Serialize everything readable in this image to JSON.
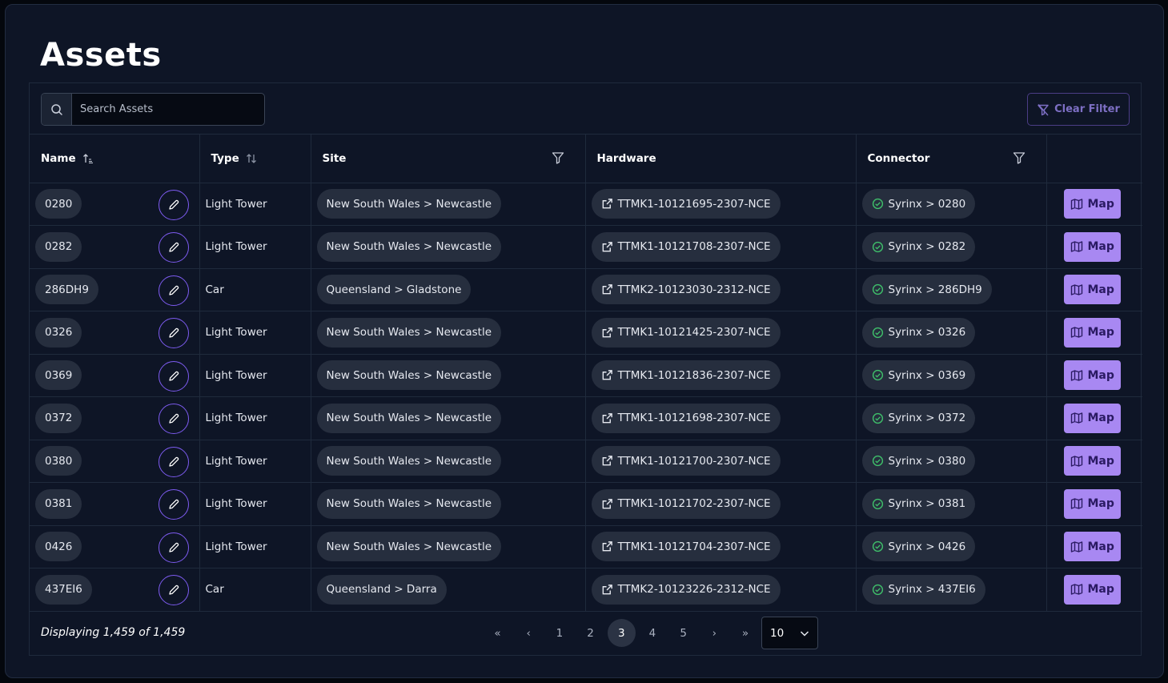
{
  "page": {
    "title": "Assets"
  },
  "search": {
    "placeholder": "Search Assets",
    "value": ""
  },
  "toolbar": {
    "clear_filter_label": "Clear Filter"
  },
  "table": {
    "columns": {
      "name": "Name",
      "type": "Type",
      "site": "Site",
      "hardware": "Hardware",
      "connector": "Connector"
    },
    "map_label": "Map",
    "rows": [
      {
        "name": "0280",
        "type": "Light Tower",
        "site": "New South Wales > Newcastle",
        "hardware": "TTMK1-10121695-2307-NCE",
        "connector": "Syrinx > 0280"
      },
      {
        "name": "0282",
        "type": "Light Tower",
        "site": "New South Wales > Newcastle",
        "hardware": "TTMK1-10121708-2307-NCE",
        "connector": "Syrinx > 0282"
      },
      {
        "name": "286DH9",
        "type": "Car",
        "site": "Queensland > Gladstone",
        "hardware": "TTMK2-10123030-2312-NCE",
        "connector": "Syrinx > 286DH9"
      },
      {
        "name": "0326",
        "type": "Light Tower",
        "site": "New South Wales > Newcastle",
        "hardware": "TTMK1-10121425-2307-NCE",
        "connector": "Syrinx > 0326"
      },
      {
        "name": "0369",
        "type": "Light Tower",
        "site": "New South Wales > Newcastle",
        "hardware": "TTMK1-10121836-2307-NCE",
        "connector": "Syrinx > 0369"
      },
      {
        "name": "0372",
        "type": "Light Tower",
        "site": "New South Wales > Newcastle",
        "hardware": "TTMK1-10121698-2307-NCE",
        "connector": "Syrinx > 0372"
      },
      {
        "name": "0380",
        "type": "Light Tower",
        "site": "New South Wales > Newcastle",
        "hardware": "TTMK1-10121700-2307-NCE",
        "connector": "Syrinx > 0380"
      },
      {
        "name": "0381",
        "type": "Light Tower",
        "site": "New South Wales > Newcastle",
        "hardware": "TTMK1-10121702-2307-NCE",
        "connector": "Syrinx > 0381"
      },
      {
        "name": "0426",
        "type": "Light Tower",
        "site": "New South Wales > Newcastle",
        "hardware": "TTMK1-10121704-2307-NCE",
        "connector": "Syrinx > 0426"
      },
      {
        "name": "437EI6",
        "type": "Car",
        "site": "Queensland > Darra",
        "hardware": "TTMK2-10123226-2312-NCE",
        "connector": "Syrinx > 437EI6"
      }
    ]
  },
  "footer": {
    "displaying": "Displaying 1,459 of 1,459",
    "first": "«",
    "prev": "‹",
    "next": "›",
    "last": "»",
    "pages": [
      "1",
      "2",
      "3",
      "4",
      "5"
    ],
    "current_page": "3",
    "page_size": "10"
  },
  "colors": {
    "accent": "#a888f2",
    "edit_ring": "#7d5bf0",
    "check": "#3fbf6a",
    "background": "#0e1526"
  },
  "icons": {
    "search": "search-icon",
    "filter": "filter-icon",
    "edit": "pencil-icon",
    "link": "external-link-icon",
    "check": "check-circle-icon",
    "map": "map-icon"
  }
}
